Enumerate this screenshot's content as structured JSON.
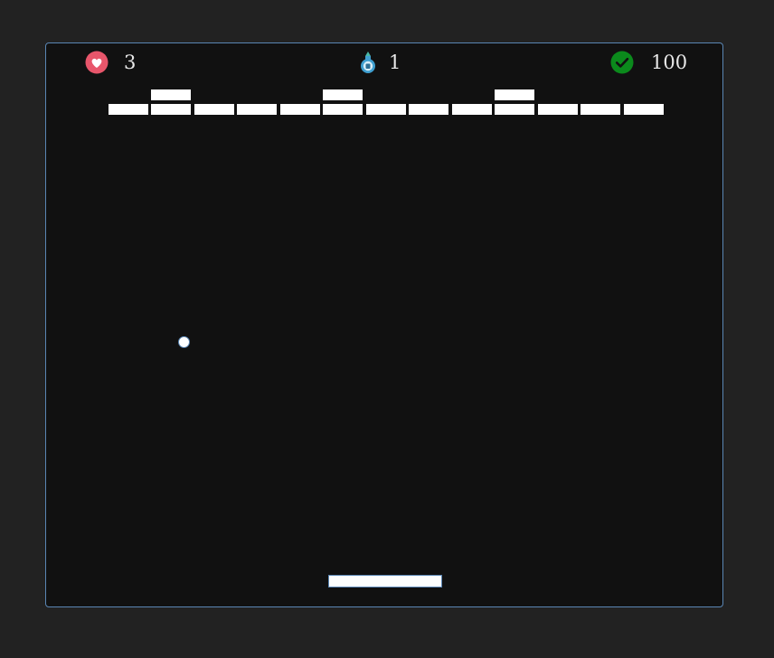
{
  "hud": {
    "lives": {
      "icon": "heart-icon",
      "value": "3",
      "color": "#e8566b"
    },
    "level": {
      "icon": "potion-bottle-icon",
      "value": "1",
      "color": "#4aa6d6"
    },
    "score": {
      "icon": "checkmark-icon",
      "value": "100",
      "color": "#0b8a1c"
    }
  },
  "colors": {
    "background": "#222222",
    "board": "#111111",
    "border": "#5a86b4",
    "brick": "#ffffff"
  },
  "board": {
    "brick_rows": 2,
    "brick_columns": 13,
    "bricks_remaining": 16
  }
}
